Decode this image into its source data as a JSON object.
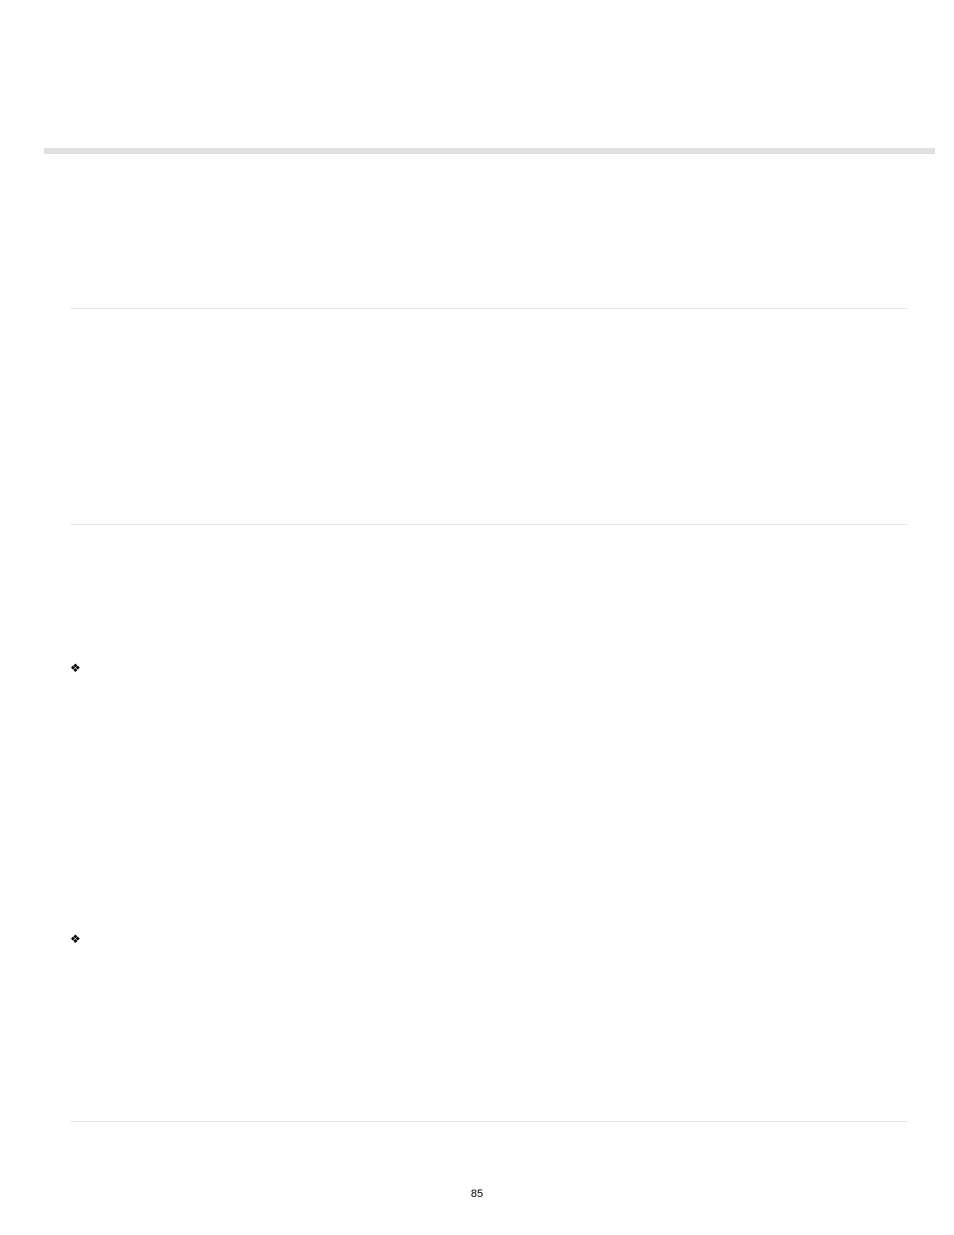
{
  "page": {
    "number": "85"
  },
  "bullets": {
    "b1": "❖",
    "b2": "❖"
  }
}
